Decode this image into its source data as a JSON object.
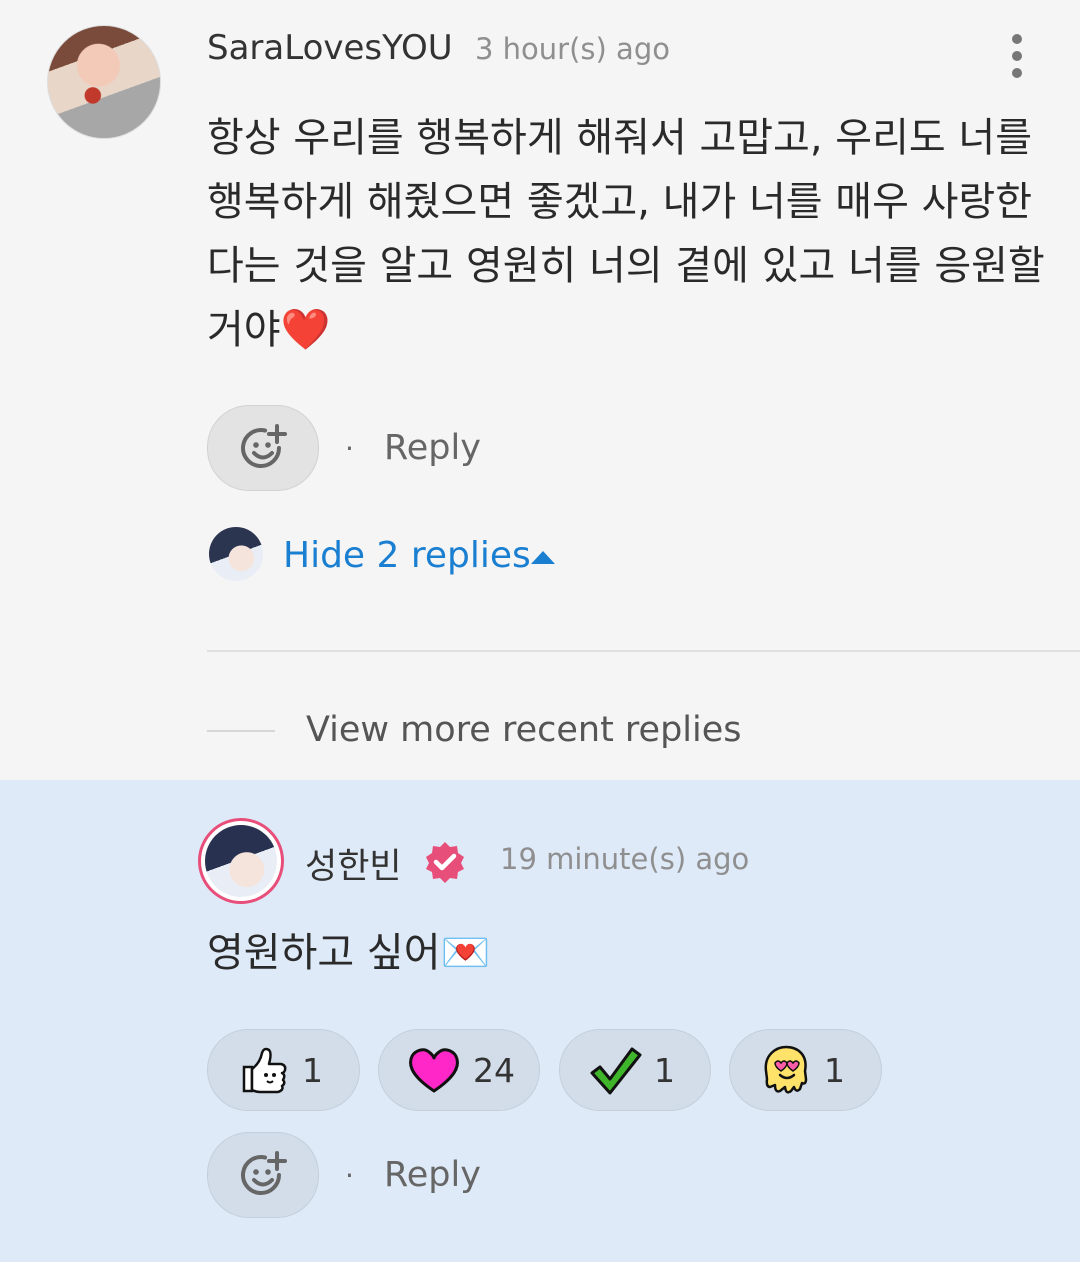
{
  "comment": {
    "username": "SaraLovesYOU",
    "timestamp": "3 hour(s) ago",
    "text": "항상 우리를 행복하게 해줘서 고맙고, 우리도 너를 행복하게 해줬으면 좋겠고, 내가 너를 매우 사랑한다는 것을 알고 영원히 너의 곁에 있고 너를 응원할 거야❤️",
    "reply_label": "Reply",
    "separator": "·",
    "hide_replies": "Hide 2 replies"
  },
  "view_more": "View more recent replies",
  "reply": {
    "username": "성한빈",
    "timestamp": "19 minute(s) ago",
    "text": "영원하고 싶어💌",
    "reply_label": "Reply",
    "separator": "·",
    "reactions": [
      {
        "icon": "thumbs-up-icon",
        "count": "1"
      },
      {
        "icon": "heart-icon",
        "count": "24"
      },
      {
        "icon": "checkmark-icon",
        "count": "1"
      },
      {
        "icon": "heart-eyes-icon",
        "count": "1"
      }
    ]
  },
  "colors": {
    "link": "#1a7fd1",
    "verified": "#e84e7a",
    "reply_background": "#dfeaf8"
  }
}
